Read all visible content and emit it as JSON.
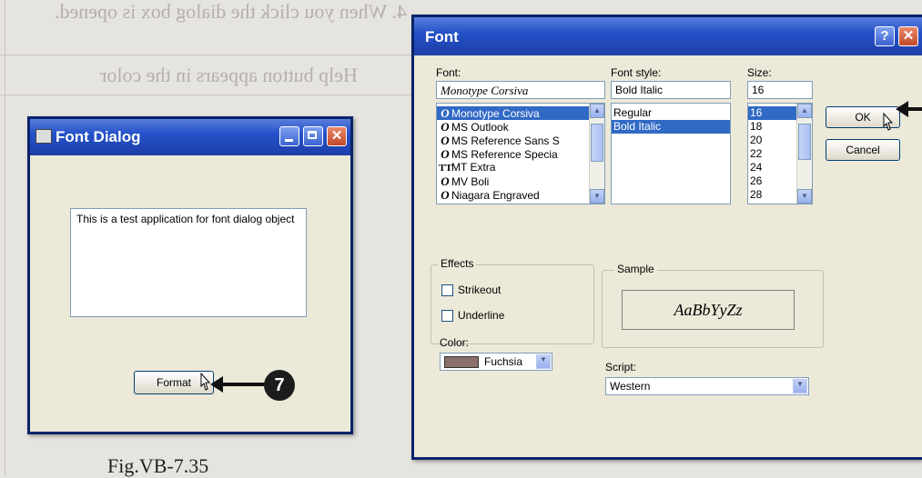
{
  "page": {
    "background_lines": [
      {
        "text": "4.    When you click the dialog box is opened.",
        "mirror": true
      },
      {
        "text": "Help button appears in the color",
        "mirror": true
      },
      {
        "text": "Fig.VB-7.35"
      }
    ]
  },
  "small_window": {
    "title": "Font Dialog",
    "textbox_text": "This is a test application for font dialog object",
    "format_button_label": "Format",
    "step_number": "7"
  },
  "font_window": {
    "title": "Font",
    "help_label": "?",
    "font_label": "Font:",
    "font_value": "Monotype Corsiva",
    "font_list": [
      {
        "icon": "O",
        "name": "Monotype Corsiva",
        "selected": true
      },
      {
        "icon": "O",
        "name": "MS Outlook",
        "selected": false
      },
      {
        "icon": "O",
        "name": "MS Reference Sans S",
        "selected": false
      },
      {
        "icon": "O",
        "name": "MS Reference Specia",
        "selected": false
      },
      {
        "icon": "TT",
        "name": "MT Extra",
        "selected": false
      },
      {
        "icon": "O",
        "name": "MV Boli",
        "selected": false
      },
      {
        "icon": "O",
        "name": "Niagara Engraved",
        "selected": false
      }
    ],
    "style_label": "Font style:",
    "style_value": "Bold Italic",
    "style_list": [
      {
        "name": "Regular",
        "selected": false
      },
      {
        "name": "Bold Italic",
        "selected": true
      }
    ],
    "size_label": "Size:",
    "size_value": "16",
    "size_list": [
      {
        "name": "16",
        "selected": true
      },
      {
        "name": "18",
        "selected": false
      },
      {
        "name": "20",
        "selected": false
      },
      {
        "name": "22",
        "selected": false
      },
      {
        "name": "24",
        "selected": false
      },
      {
        "name": "26",
        "selected": false
      },
      {
        "name": "28",
        "selected": false
      }
    ],
    "ok_label": "OK",
    "cancel_label": "Cancel",
    "effects_label": "Effects",
    "strikeout_label": "Strikeout",
    "underline_label": "Underline",
    "color_label": "Color:",
    "color_value": "Fuchsia",
    "sample_label": "Sample",
    "sample_text": "AaBbYyZz",
    "script_label": "Script:",
    "script_value": "Western"
  },
  "colors": {
    "titlebar": "#2452c9",
    "selection": "#316ac5",
    "window_face": "#ece9d8",
    "color_swatch": "#8a7068"
  }
}
